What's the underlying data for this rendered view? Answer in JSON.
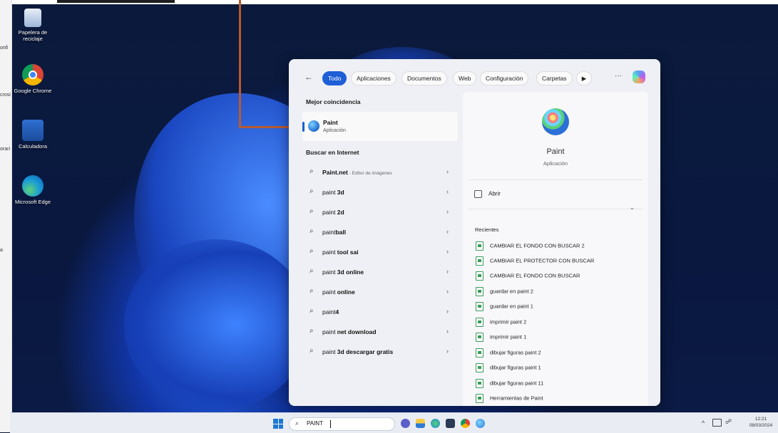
{
  "left_strip": {
    "texts": [
      "onfi",
      "crosi",
      "orari",
      "a"
    ]
  },
  "desktop_icons": [
    {
      "label_line1": "Papelera de",
      "label_line2": "reciclaje",
      "icon": "recycle-bin-icon"
    },
    {
      "label_line1": "Google Chrome",
      "label_line2": "",
      "icon": "chrome-icon"
    },
    {
      "label_line1": "Calculadora",
      "label_line2": "",
      "icon": "calculator-icon"
    },
    {
      "label_line1": "Microsoft Edge",
      "label_line2": "",
      "icon": "edge-icon"
    }
  ],
  "search": {
    "tabs": [
      "Todo",
      "Aplicaciones",
      "Documentos",
      "Web",
      "Configuración",
      "Carpetas"
    ],
    "more": "···",
    "best_match_heading": "Mejor coincidencia",
    "best_match": {
      "name": "Paint",
      "type": "Aplicación"
    },
    "internet_heading": "Buscar en Internet",
    "results": [
      {
        "bold": "Paint.net",
        "rest": " - Editor de imágenes",
        "note": true
      },
      {
        "plain": "paint ",
        "bold": "3d"
      },
      {
        "plain": "paint ",
        "bold": "2d"
      },
      {
        "plain": "paint",
        "bold": "ball"
      },
      {
        "plain": "paint ",
        "bold": "tool sai"
      },
      {
        "plain": "paint ",
        "bold": "3d online"
      },
      {
        "plain": "paint ",
        "bold": "online"
      },
      {
        "plain": "paint",
        "bold": "4"
      },
      {
        "plain": "paint ",
        "bold": "net download"
      },
      {
        "plain": "paint ",
        "bold": "3d descargar gratis"
      }
    ],
    "detail": {
      "title": "Paint",
      "subtitle": "Aplicación",
      "open_label": "Abrir",
      "recent_heading": "Recientes",
      "recent": [
        "CAMBIAR EL FONDO CON BUSCAR 2",
        "CAMBIAR EL PROTECTOR CON BUSCAR",
        "CAMBIAR EL FONDO CON BUSCAR",
        "guardar en paint 2",
        "guardar en paint 1",
        "imprimir paint 2",
        "imprimir paint 1",
        "dibujar figuras paint 2",
        "dibujar figuras paint 1",
        "dibujar figuras paint 11",
        "Herramientas de Paint"
      ]
    }
  },
  "taskbar": {
    "search_value": "PAINT",
    "clock_time": "12:21",
    "clock_date": "08/03/2024",
    "tray_chevron": "^"
  },
  "colors": {
    "accent": "#1f5fd6",
    "annotation": "#b85a2e"
  }
}
